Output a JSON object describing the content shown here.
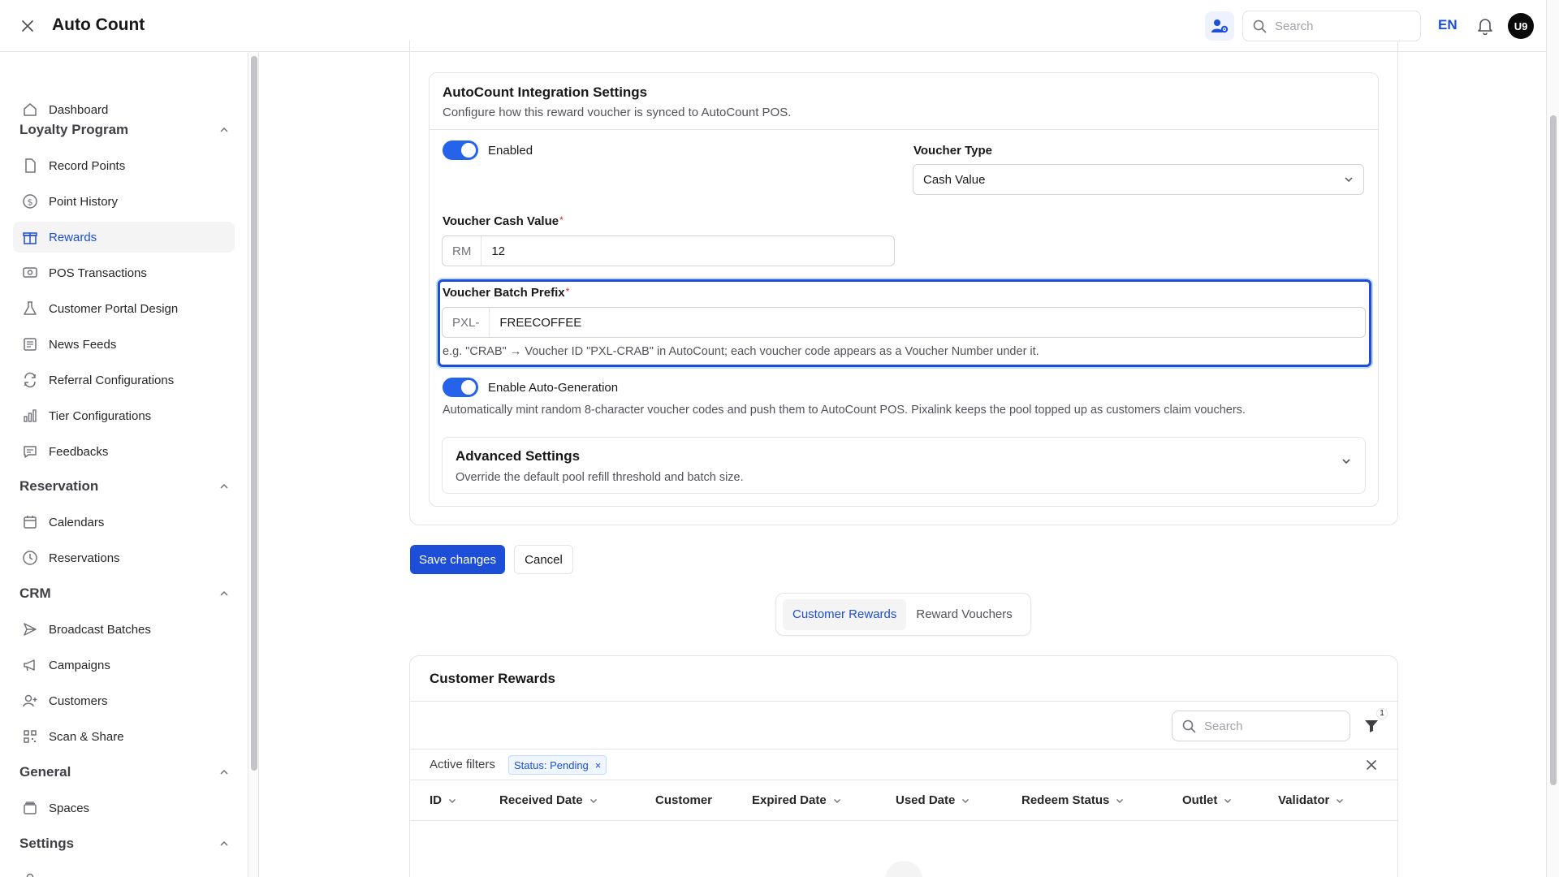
{
  "header": {
    "title": "Auto Count",
    "search_placeholder": "Search",
    "language": "EN",
    "avatar_initials": "U9"
  },
  "sidebar": {
    "dashboard": "Dashboard",
    "sections": {
      "loyalty": "Loyalty Program",
      "reservation": "Reservation",
      "crm": "CRM",
      "general": "General",
      "settings": "Settings"
    },
    "loyalty_items": [
      "Record Points",
      "Point History",
      "Rewards",
      "POS Transactions",
      "Customer Portal Design",
      "News Feeds",
      "Referral Configurations",
      "Tier Configurations",
      "Feedbacks"
    ],
    "reservation_items": [
      "Calendars",
      "Reservations"
    ],
    "crm_items": [
      "Broadcast Batches",
      "Campaigns",
      "Customers",
      "Scan & Share"
    ],
    "general_items": [
      "Spaces"
    ],
    "active_item": "Rewards"
  },
  "integration": {
    "title": "AutoCount Integration Settings",
    "subtitle": "Configure how this reward voucher is synced to AutoCount POS.",
    "enabled_label": "Enabled",
    "enabled": true,
    "voucher_type_label": "Voucher Type",
    "voucher_type_value": "Cash Value",
    "cash_value_label": "Voucher Cash Value",
    "cash_currency": "RM",
    "cash_value": "12",
    "prefix_label": "Voucher Batch Prefix",
    "prefix_addon": "PXL-",
    "prefix_value": "FREECOFFEE",
    "prefix_helper": "e.g. \"CRAB\" → Voucher ID \"PXL-CRAB\" in AutoCount; each voucher code appears as a Voucher Number under it.",
    "autogen_label": "Enable Auto-Generation",
    "autogen_enabled": true,
    "autogen_helper": "Automatically mint random 8-character voucher codes and push them to AutoCount POS. Pixalink keeps the pool topped up as customers claim vouchers.",
    "advanced_title": "Advanced Settings",
    "advanced_subtitle": "Override the default pool refill threshold and batch size."
  },
  "actions": {
    "save": "Save changes",
    "cancel": "Cancel"
  },
  "tabs": {
    "customer_rewards": "Customer Rewards",
    "reward_vouchers": "Reward Vouchers",
    "active": "Customer Rewards"
  },
  "customer_rewards": {
    "title": "Customer Rewards",
    "search_placeholder": "Search",
    "filter_count": "1",
    "active_filters_label": "Active filters",
    "filter_chip": "Status: Pending",
    "columns": [
      "ID",
      "Received Date",
      "Customer",
      "Expired Date",
      "Used Date",
      "Redeem Status",
      "Outlet",
      "Validator"
    ]
  },
  "colors": {
    "accent": "#1d4ed8",
    "toggle_on": "#2563eb"
  }
}
